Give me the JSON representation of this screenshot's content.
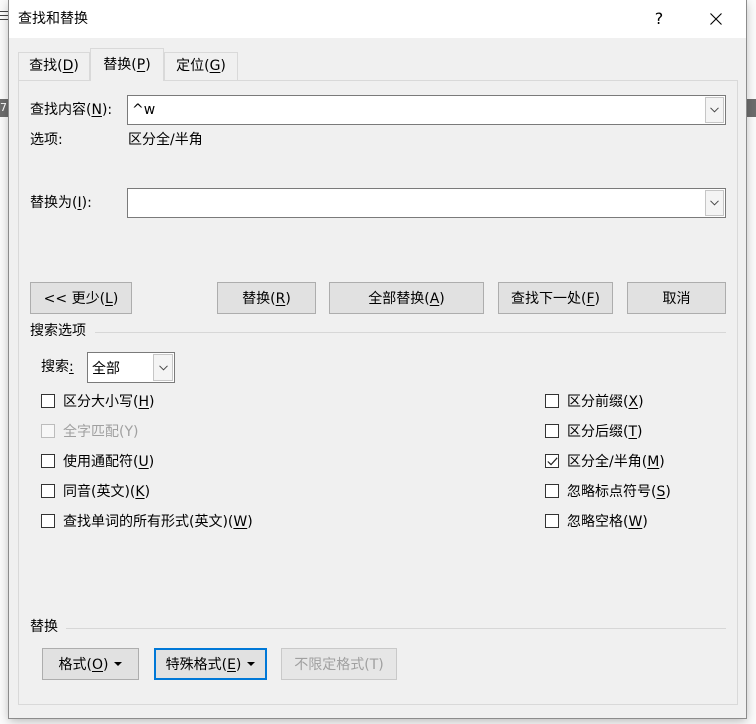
{
  "background": {
    "ruler_number": "7"
  },
  "dialog": {
    "title": "查找和替换",
    "help_label": "?",
    "tabs": [
      {
        "label": "查找(D)",
        "selected": false
      },
      {
        "label": "替换(P)",
        "selected": true
      },
      {
        "label": "定位(G)",
        "selected": false
      }
    ],
    "find": {
      "label": "查找内容(N):",
      "value": "^w"
    },
    "options": {
      "label": "选项:",
      "value": "区分全/半角"
    },
    "replace": {
      "label": "替换为(I):",
      "value": ""
    },
    "buttons": {
      "less": {
        "label": "<< 更少(L)",
        "enabled": true
      },
      "replace": {
        "label": "替换(R)",
        "enabled": true
      },
      "replace_all": {
        "label": "全部替换(A)",
        "enabled": true
      },
      "find_next": {
        "label": "查找下一处(F)",
        "enabled": true
      },
      "cancel": {
        "label": "取消",
        "enabled": true
      }
    },
    "search_options": {
      "heading": "搜索选项",
      "search_label": "搜索:",
      "search_value": "全部",
      "left_checks": [
        {
          "label": "区分大小写(H)",
          "checked": false,
          "enabled": true
        },
        {
          "label": "全字匹配(Y)",
          "checked": false,
          "enabled": false
        },
        {
          "label": "使用通配符(U)",
          "checked": false,
          "enabled": true
        },
        {
          "label": "同音(英文)(K)",
          "checked": false,
          "enabled": true
        },
        {
          "label": "查找单词的所有形式(英文)(W)",
          "checked": false,
          "enabled": true
        }
      ],
      "right_checks": [
        {
          "label": "区分前缀(X)",
          "checked": false,
          "enabled": true
        },
        {
          "label": "区分后缀(T)",
          "checked": false,
          "enabled": true
        },
        {
          "label": "区分全/半角(M)",
          "checked": true,
          "enabled": true
        },
        {
          "label": "忽略标点符号(S)",
          "checked": false,
          "enabled": true
        },
        {
          "label": "忽略空格(W)",
          "checked": false,
          "enabled": true
        }
      ]
    },
    "replace_section": {
      "heading": "替换",
      "format": {
        "label": "格式(O)",
        "enabled": true,
        "focused": false
      },
      "special": {
        "label": "特殊格式(E)",
        "enabled": true,
        "focused": true
      },
      "no_format": {
        "label": "不限定格式(T)",
        "enabled": false,
        "focused": false
      }
    }
  },
  "colors": {
    "dialog_background": "#f0f0f0",
    "button_background": "#e1e1e1",
    "focus_border": "#0078d7",
    "disabled_text": "#a0a0a0"
  }
}
